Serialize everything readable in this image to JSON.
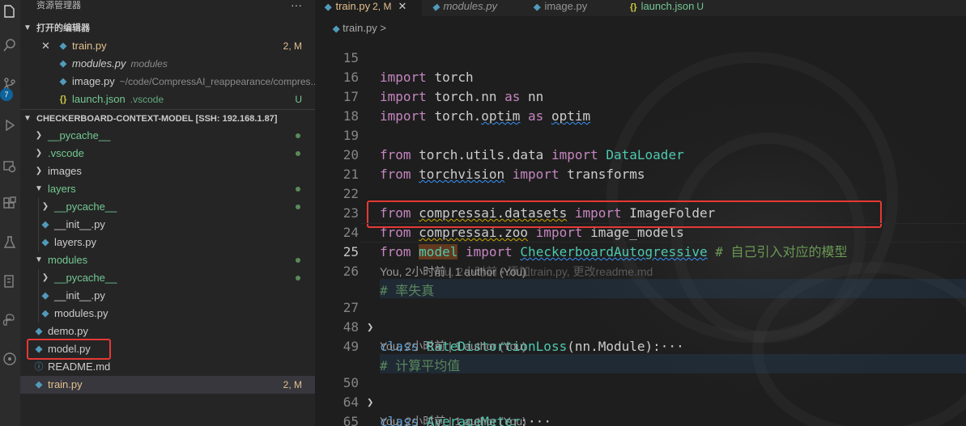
{
  "activity_bar": {
    "icons": [
      "files-icon",
      "search-icon",
      "source-control-icon",
      "run-debug-icon",
      "remote-explorer-icon",
      "extensions-icon",
      "testing-icon",
      "docker-icon",
      "python-icon",
      "git-graph-icon"
    ],
    "badge": "7"
  },
  "sidebar": {
    "title": "资源管理器",
    "more": "···",
    "open_editors": {
      "header": "打开的编辑器",
      "items": [
        {
          "name": "train.py",
          "desc": "",
          "status": "2, M"
        },
        {
          "name": "modules.py",
          "desc": "modules",
          "status": ""
        },
        {
          "name": "image.py",
          "desc": "~/code/CompressAI_reappearance/compres...",
          "status": ""
        },
        {
          "name": "launch.json",
          "desc": ".vscode",
          "status": "U"
        }
      ]
    },
    "workspace": {
      "header": "CHECKERBOARD-CONTEXT-MODEL [SSH: 192.168.1.87]",
      "items": [
        {
          "name": "__pycache__"
        },
        {
          "name": ".vscode"
        },
        {
          "name": "images"
        },
        {
          "name": "layers"
        },
        {
          "name": "__pycache__"
        },
        {
          "name": "__init__.py"
        },
        {
          "name": "layers.py"
        },
        {
          "name": "modules"
        },
        {
          "name": "__pycache__"
        },
        {
          "name": "__init__.py"
        },
        {
          "name": "modules.py"
        },
        {
          "name": "demo.py"
        },
        {
          "name": "model.py"
        },
        {
          "name": "README.md"
        },
        {
          "name": "train.py",
          "status": "2, M"
        }
      ]
    }
  },
  "tabs": [
    {
      "name": "train.py",
      "status": "2, M",
      "close": "✕"
    },
    {
      "name": "modules.py"
    },
    {
      "name": "image.py"
    },
    {
      "name": "launch.json",
      "status": "U"
    }
  ],
  "breadcrumb": {
    "file": "train.py",
    "sep": ">"
  },
  "editor": {
    "line_numbers": [
      "15",
      "16",
      "17",
      "18",
      "19",
      "20",
      "21",
      "22",
      "23",
      "24",
      "25",
      "26",
      "27",
      "48",
      "49",
      "50",
      "64",
      "65"
    ],
    "code": {
      "l15": [
        "import",
        "torch"
      ],
      "l16": [
        "import",
        "torch.nn",
        "as",
        "nn"
      ],
      "l17": [
        "import",
        "torch.",
        "optim",
        "as",
        "optim"
      ],
      "l19": [
        "from",
        "torch.utils.data",
        "import",
        "DataLoader"
      ],
      "l20": [
        "from",
        "torchvision",
        "import",
        "transforms"
      ],
      "l22": [
        "from",
        "compressai.datasets",
        "import",
        "ImageFolder"
      ],
      "l23": [
        "from",
        "compressai.zoo",
        "import",
        "image_models"
      ],
      "l24": [
        "from",
        "model",
        "import",
        "CheckerboardAutogressive",
        "# 自己引入对应的模型"
      ],
      "l25_blame": "You, 2小时前 • 添加train.py, 更改readme.md",
      "l26": "# 率失真",
      "l27": [
        "class",
        "RateDistortionLoss",
        "(nn.Module):",
        "···"
      ],
      "l49": "# 计算平均值",
      "l50": [
        "class",
        "AverageMeter",
        ":",
        "···"
      ]
    },
    "codelens": "You, 2小时前 | 1 author (You)"
  }
}
